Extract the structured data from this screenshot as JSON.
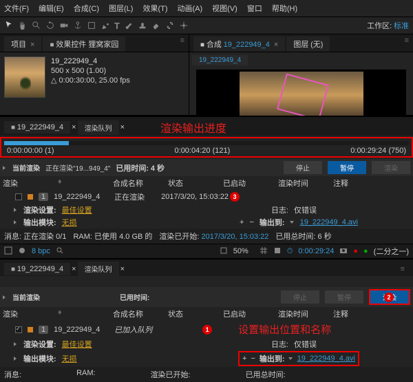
{
  "menu": {
    "file": "文件(F)",
    "edit": "编辑(E)",
    "comp": "合成(C)",
    "layer": "图层(L)",
    "effect": "效果(T)",
    "anim": "动画(A)",
    "view": "视图(V)",
    "window": "窗口",
    "help": "帮助(H)"
  },
  "workspace": {
    "label": "工作区:",
    "value": "标准"
  },
  "project": {
    "tab_project": "项目",
    "tab_effects": "效果控件 狸窝家园",
    "name": "19_222949_4",
    "dims": "500 x 500 (1.00)",
    "dur": "0:00:30:00, 25.00 fps",
    "item": "19_222949_4",
    "rq_tab": "渲染队列"
  },
  "comp": {
    "tab_label": "合成",
    "name": "19_222949_4",
    "layers_label": "图层",
    "none": "(无)",
    "comp_tab": "19_222949_4"
  },
  "rq": {
    "annotation_top": "渲染输出进度",
    "t0": "0:00:00:00 (1)",
    "t1": "0:00:04:20 (121)",
    "t2": "0:00:29:24 (750)",
    "cur_label": "当前渲染",
    "rendering": "正在渲染\"19...949_4\"",
    "elapsed_label": "已用时间:",
    "elapsed": "4 秒",
    "btn_stop": "停止",
    "btn_pause": "暂停",
    "btn_render": "渲染",
    "hdr_render": "渲染",
    "hdr_comp": "合成名称",
    "hdr_status": "状态",
    "hdr_started": "已启动",
    "hdr_rtime": "渲染时间",
    "hdr_notes": "注释",
    "item_num": "1",
    "item_name": "19_222949_4",
    "item_status": "正在渲染",
    "item_started": "2017/3/20, 15:03:22",
    "rs_label": "渲染设置:",
    "rs_value": "最佳设置",
    "log_label": "日志:",
    "log_value": "仅错误",
    "om_label": "输出模块:",
    "om_value": "无损",
    "out_label": "输出到:",
    "out_file": "19_222949_4.avi",
    "msg_label": "消息:",
    "msg_val": "正在渲染 0/1",
    "ram_label": "RAM:",
    "ram_val": "已使用 4.0 GB 的",
    "rstart_label": "渲染已开始:",
    "rstart_val": "2017/3/20, 15:03:22",
    "total_label": "已用总时间:",
    "total_val": "6 秒",
    "plus": "+",
    "minus": "−"
  },
  "rq2": {
    "item_status": "已加入队列",
    "annotation": "设置输出位置和名称",
    "msg_label": "消息:",
    "ram_label": "RAM:",
    "rstart_label": "渲染已开始:",
    "total_label": "已用总时间:"
  },
  "footer": {
    "bpc": "8 bpc",
    "zoom": "50%",
    "timecode": "0:00:29:24",
    "res": "(二分之一)"
  },
  "badges": {
    "b1": "1",
    "b2": "2",
    "b3": "3"
  }
}
